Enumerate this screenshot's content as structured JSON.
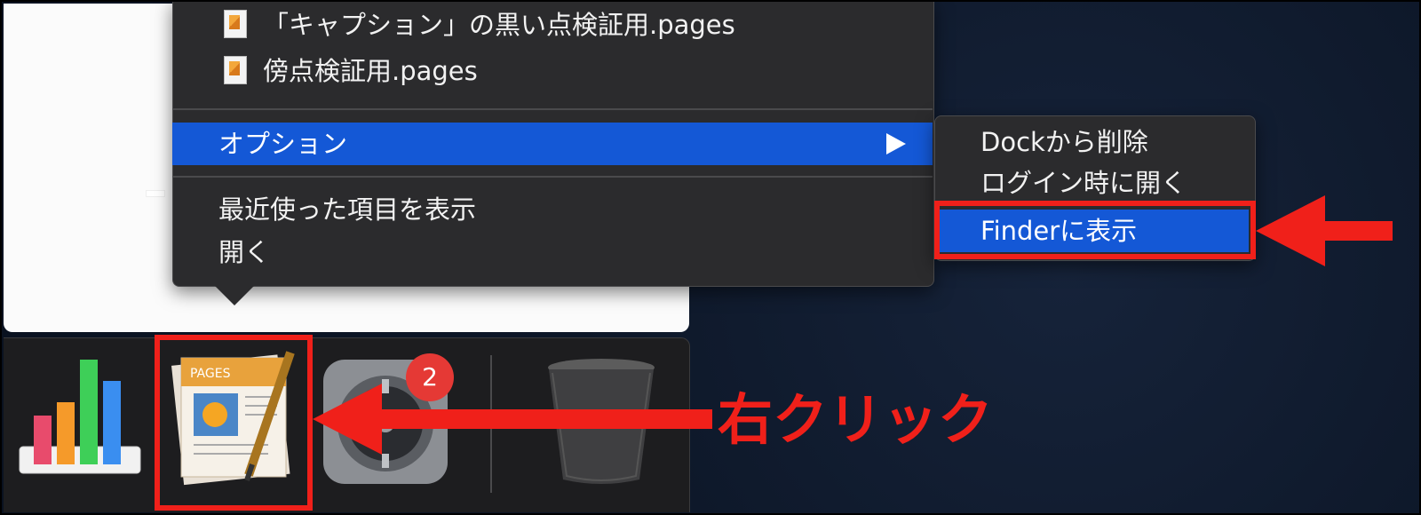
{
  "menu": {
    "recent_docs": [
      {
        "label": "「キャプション」の黒い点検証用.pages",
        "icon": "pages-document-icon"
      },
      {
        "label": "傍点検証用.pages",
        "icon": "pages-document-icon"
      }
    ],
    "options_label": "オプション",
    "show_recent_label": "最近使った項目を表示",
    "open_label": "開く"
  },
  "submenu": {
    "items": [
      "Dockから削除",
      "ログイン時に開く",
      "Finderに表示"
    ],
    "highlighted": "Finderに表示"
  },
  "dock": {
    "apps": [
      "numbers-app-icon",
      "pages-app-icon",
      "system-preferences-icon",
      "trash-icon"
    ],
    "system_preferences_badge": "2"
  },
  "annotation": {
    "right_click_label": "右クリック",
    "color": "#f0201a"
  },
  "colors": {
    "highlight": "#1458d6",
    "menu_bg": "#2b2b2d"
  }
}
